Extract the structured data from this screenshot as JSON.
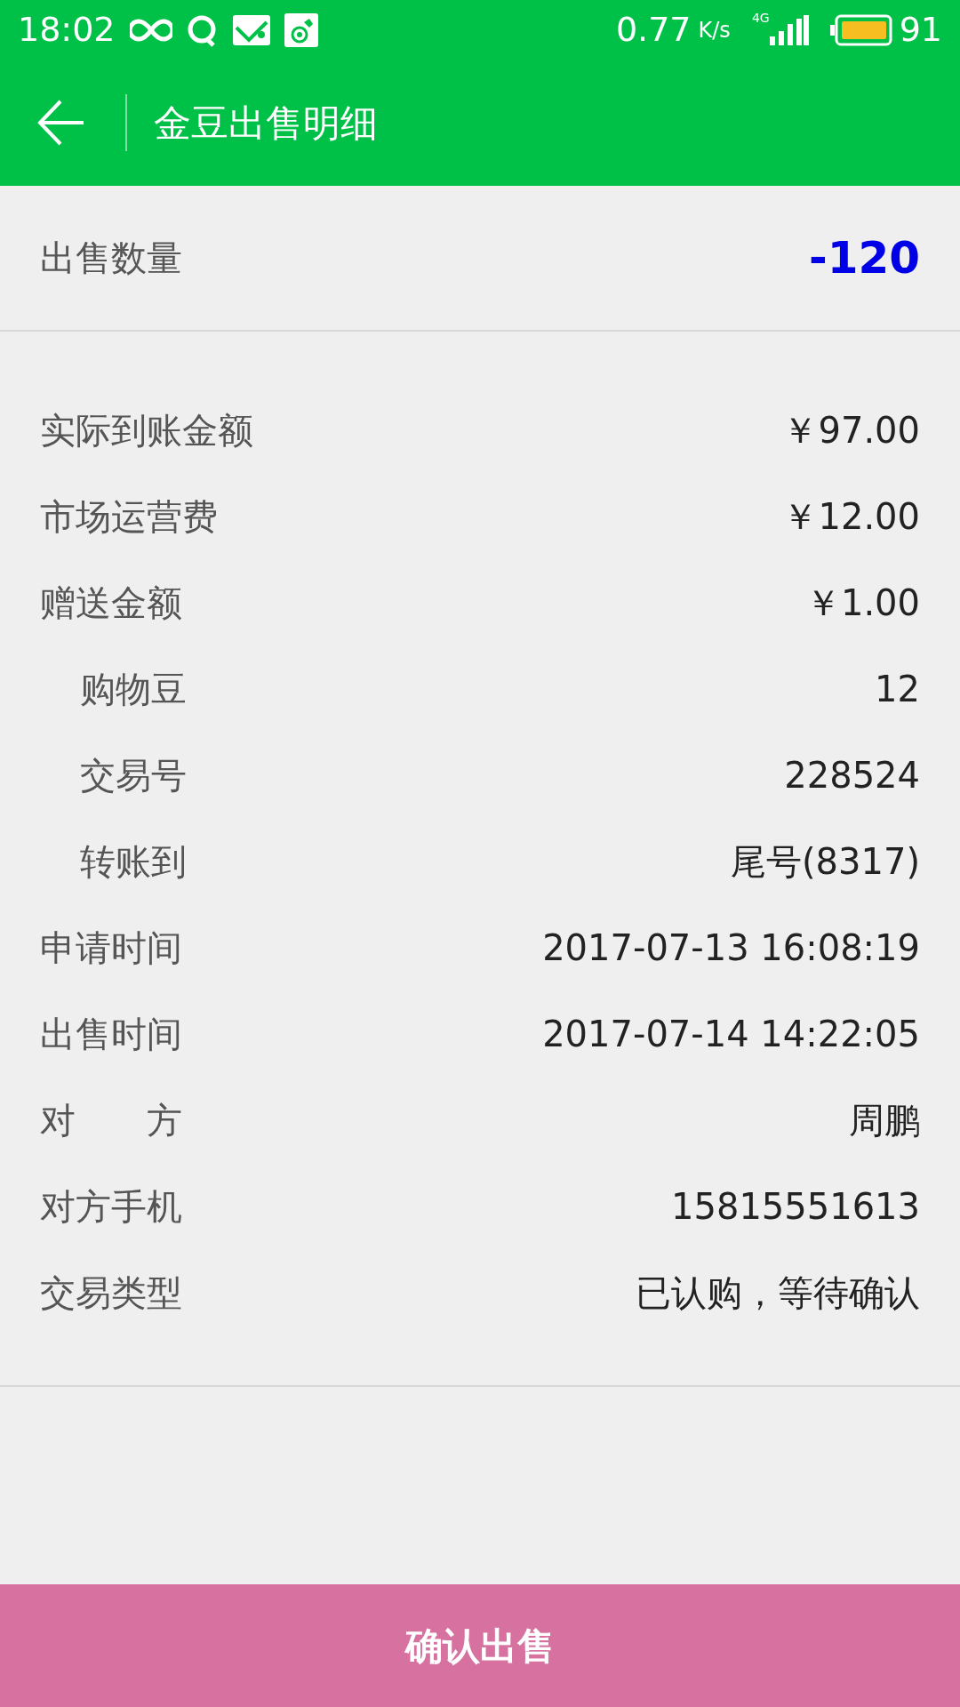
{
  "status_bar": {
    "time": "18:02",
    "speed": "0.77",
    "speed_unit": "K/s",
    "network": "4G",
    "battery": "91"
  },
  "toolbar": {
    "title": "金豆出售明细"
  },
  "quantity": {
    "label": "出售数量",
    "value": "-120"
  },
  "details": [
    {
      "kind": "main",
      "label": "实际到账金额",
      "value": "￥97.00"
    },
    {
      "kind": "main",
      "label": "市场运营费",
      "value": "￥12.00"
    },
    {
      "kind": "main",
      "label": "赠送金额",
      "value": "￥1.00"
    },
    {
      "kind": "sub",
      "label": "购物豆",
      "value": "12"
    },
    {
      "kind": "sub",
      "label": "交易号",
      "value": "228524"
    },
    {
      "kind": "sub",
      "label": "转账到",
      "value": "尾号(8317)"
    },
    {
      "kind": "main",
      "label": "申请时间",
      "value": "2017-07-13 16:08:19"
    },
    {
      "kind": "main",
      "label": "出售时间",
      "value": "2017-07-14 14:22:05"
    },
    {
      "kind": "main",
      "label": "对　　方",
      "value": "周鹏"
    },
    {
      "kind": "main",
      "label": "对方手机",
      "value": "15815551613"
    },
    {
      "kind": "main",
      "label": "交易类型",
      "value": "已认购，等待确认"
    }
  ],
  "confirm_button": "确认出售"
}
